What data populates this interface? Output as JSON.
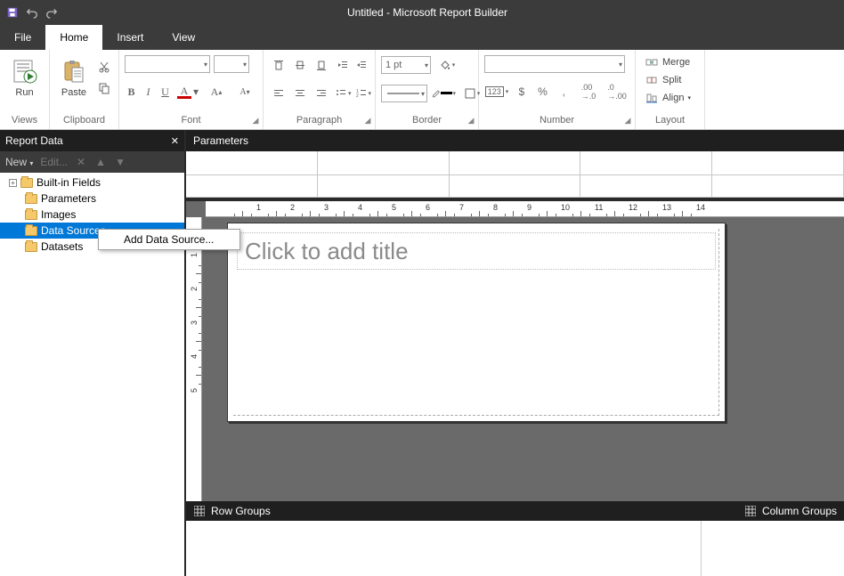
{
  "title": "Untitled - Microsoft Report Builder",
  "menu": {
    "file": "File",
    "home": "Home",
    "insert": "Insert",
    "view": "View"
  },
  "ribbon": {
    "views": {
      "run": "Run",
      "label": "Views"
    },
    "clipboard": {
      "paste": "Paste",
      "label": "Clipboard"
    },
    "font": {
      "label": "Font",
      "bold": "B",
      "italic": "I",
      "underline": "U"
    },
    "paragraph": {
      "label": "Paragraph"
    },
    "border": {
      "label": "Border",
      "width": "1 pt"
    },
    "number": {
      "label": "Number",
      "sample": "$",
      "pct": "%",
      "comma": ","
    },
    "layout": {
      "label": "Layout",
      "merge": "Merge",
      "split": "Split",
      "align": "Align"
    }
  },
  "reportData": {
    "title": "Report Data",
    "toolbar": {
      "newBtn": "New",
      "edit": "Edit..."
    },
    "tree": {
      "builtin": "Built-in Fields",
      "parameters": "Parameters",
      "images": "Images",
      "dataSources": "Data Sources",
      "datasets": "Datasets"
    },
    "contextMenu": {
      "addDataSource": "Add Data Source..."
    }
  },
  "design": {
    "parametersHeader": "Parameters",
    "paramColumns": 5,
    "titlePlaceholder": "Click to add title",
    "rulerNumbers": [
      1,
      2,
      3,
      4,
      5,
      6,
      7,
      8,
      9,
      10,
      11,
      12,
      13,
      14
    ],
    "vRulerNumbers": [
      1,
      2,
      3,
      4,
      5
    ],
    "rowGroups": "Row Groups",
    "columnGroups": "Column Groups"
  }
}
